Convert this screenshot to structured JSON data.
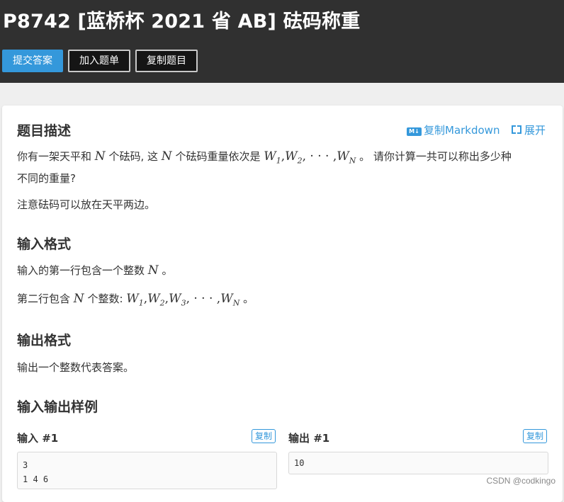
{
  "header": {
    "title": "P8742 [蓝桥杯 2021 省 AB] 砝码称重",
    "buttons": {
      "submit": "提交答案",
      "add_to_list": "加入题单",
      "copy_problem": "复制题目"
    }
  },
  "card": {
    "toolbar": {
      "copy_markdown": "复制Markdown",
      "expand": "展开",
      "md_badge": "M↓"
    },
    "sections": {
      "description": {
        "heading": "题目描述",
        "line1_a": "你有一架天平和",
        "line1_b": "个砝码, 这",
        "line1_c": "个砝码重量依次是",
        "line1_d": "。 请你计算一共可以称出多少种",
        "line2": "不同的重量?",
        "para2": "注意砝码可以放在天平两边。"
      },
      "input_format": {
        "heading": "输入格式",
        "line1_a": "输入的第一行包含一个整数",
        "line1_b": "。",
        "line2_a": "第二行包含",
        "line2_b": "个整数:",
        "line2_c": "。"
      },
      "output_format": {
        "heading": "输出格式",
        "line1": "输出一个整数代表答案。"
      },
      "samples": {
        "heading": "输入输出样例",
        "input_label": "输入 #1",
        "output_label": "输出 #1",
        "copy_label": "复制",
        "input_text": "3\n1 4 6",
        "output_text": "10"
      }
    }
  },
  "watermark": "CSDN @codkingo"
}
